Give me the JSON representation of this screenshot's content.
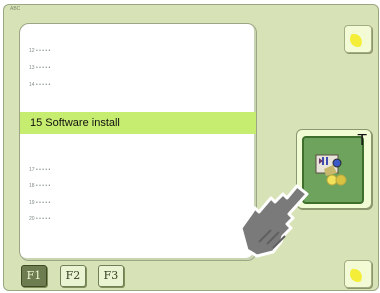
{
  "window": {
    "title": "ABC"
  },
  "list": {
    "items_before": [
      "12 • • • • •",
      "13 • • • • •",
      "14 • • • • •"
    ],
    "selected": "15 Software install",
    "items_after": [
      "17 • • • • •",
      "18 • • • • •",
      "19 • • • • •",
      "20 • • • • •"
    ]
  },
  "action": {
    "badge": "T",
    "icon": "software-install-icon"
  },
  "footer": {
    "f1": "F1",
    "f2": "F2",
    "f3": "F3"
  },
  "colors": {
    "accent": "#c6ed6f",
    "panel": "#d7e3b7",
    "button_green": "#6da35d"
  }
}
